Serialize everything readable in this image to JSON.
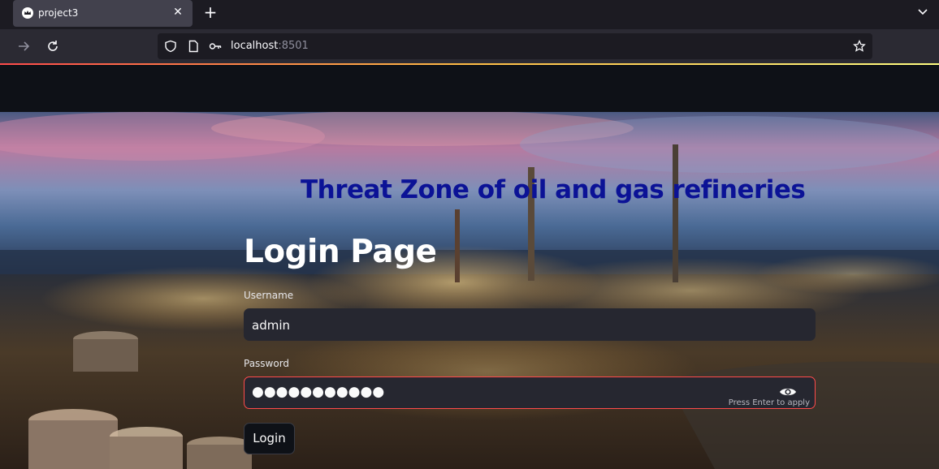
{
  "browser": {
    "tab_title": "project3",
    "url_host": "localhost",
    "url_port": ":8501",
    "icons": [
      "crown-favicon-icon",
      "close-icon",
      "plus-icon",
      "chevron-down-icon",
      "forward-arrow-icon",
      "reload-icon",
      "shield-icon",
      "page-icon",
      "key-icon",
      "star-icon"
    ]
  },
  "page": {
    "title": "Threat Zone of oil and gas refineries",
    "subtitle": "Login Page"
  },
  "form": {
    "username_label": "Username",
    "username_value": "admin",
    "password_label": "Password",
    "password_value": "●●●●●●●●●●●",
    "password_hint": "Press Enter to apply",
    "submit_label": "Login"
  },
  "colors": {
    "title_color": "#0b1296",
    "accent_red": "#ff4b4b",
    "input_bg": "#262730",
    "app_bg": "#0e1117"
  }
}
